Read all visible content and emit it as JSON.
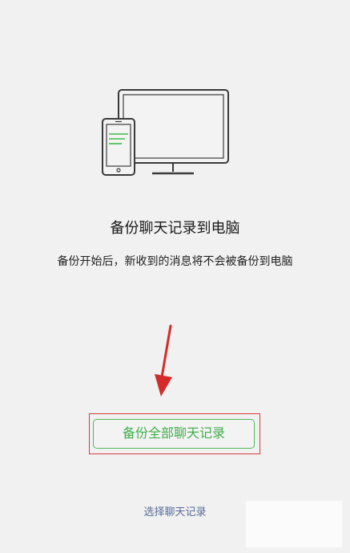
{
  "content": {
    "headline": "备份聊天记录到电脑",
    "subtext": "备份开始后，新收到的消息将不会被备份到电脑"
  },
  "actions": {
    "backup_all_label": "备份全部聊天记录",
    "select_chats_label": "选择聊天记录"
  },
  "colors": {
    "background": "#f1f1f1",
    "accent_green": "#3fae49",
    "link_blue": "#576b95",
    "annotation_red": "#d83b3b"
  },
  "icons": {
    "illustration": "phone-and-monitor-icon",
    "annotation_arrow": "arrow-down-icon"
  }
}
